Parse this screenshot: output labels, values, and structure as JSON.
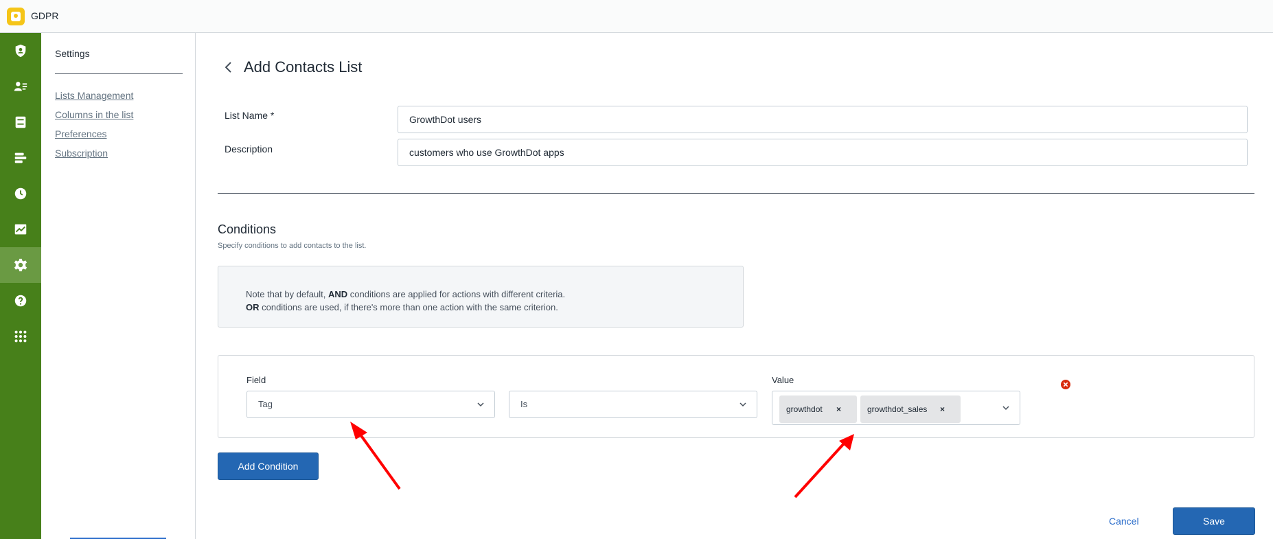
{
  "app": {
    "title": "GDPR"
  },
  "rail": {
    "icons": [
      "shield-icon",
      "contacts-icon",
      "inbox-icon",
      "list-icon",
      "clock-icon",
      "chart-icon",
      "gear-icon",
      "help-icon",
      "apps-grid-icon"
    ],
    "active": "gear-icon",
    "color": "#47801a"
  },
  "subnav": {
    "title": "Settings",
    "links": [
      "Lists Management",
      "Columns in the list",
      "Preferences",
      "Subscription"
    ]
  },
  "page": {
    "title": "Add Contacts List",
    "list_name_label": "List Name *",
    "list_name_value": "GrowthDot users",
    "description_label": "Description",
    "description_value": "customers who use GrowthDot apps"
  },
  "conditions": {
    "title": "Conditions",
    "subtitle": "Specify conditions to add contacts to the list.",
    "note": {
      "line1_pre": "Note that by default, ",
      "line1_bold": "AND",
      "line1_post": " conditions are applied for actions with different criteria.",
      "line2_bold": "OR",
      "line2_post": " conditions are used, if there's more than one action with the same criterion."
    },
    "rows": [
      {
        "field_label": "Field",
        "field_value": "Tag",
        "operator_value": "Is",
        "value_label": "Value",
        "tags": [
          "growthdot",
          "growthdot_sales"
        ],
        "chip_remove": "×"
      }
    ]
  },
  "buttons": {
    "add_condition": "Add Condition",
    "cancel": "Cancel",
    "save": "Save"
  },
  "colors": {
    "accent": "#2467b3",
    "annotation_arrow": "#ff0000",
    "remove": "#d82c0d"
  }
}
